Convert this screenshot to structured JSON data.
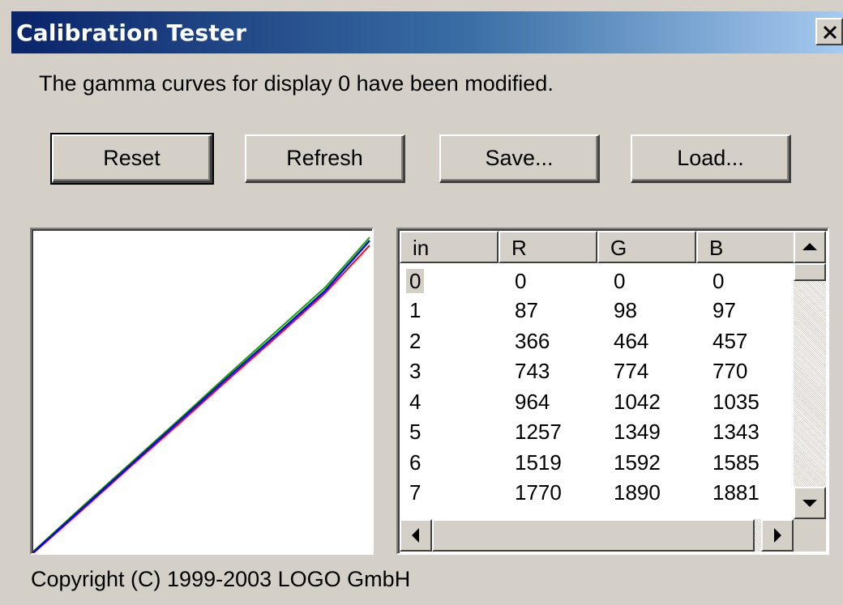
{
  "window": {
    "title": "Calibration Tester",
    "close_glyph": "✕"
  },
  "message": "The gamma curves for display 0 have been modified.",
  "buttons": {
    "reset": "Reset",
    "refresh": "Refresh",
    "save": "Save...",
    "load": "Load..."
  },
  "table": {
    "headers": [
      "in",
      "R",
      "G",
      "B"
    ],
    "rows": [
      [
        "0",
        "0",
        "0",
        "0"
      ],
      [
        "1",
        "87",
        "98",
        "97"
      ],
      [
        "2",
        "366",
        "464",
        "457"
      ],
      [
        "3",
        "743",
        "774",
        "770"
      ],
      [
        "4",
        "964",
        "1042",
        "1035"
      ],
      [
        "5",
        "1257",
        "1349",
        "1343"
      ],
      [
        "6",
        "1519",
        "1592",
        "1585"
      ],
      [
        "7",
        "1770",
        "1890",
        "1881"
      ]
    ]
  },
  "curve_colors": {
    "red": "#ff0000",
    "green": "#00b000",
    "blue": "#0000ff"
  },
  "icons": {
    "scroll_up": "triangle-up-icon",
    "scroll_down": "triangle-down-icon",
    "scroll_left": "triangle-left-icon",
    "scroll_right": "triangle-right-icon"
  },
  "copyright": "Copyright (C) 1999-2003 LOGO GmbH"
}
